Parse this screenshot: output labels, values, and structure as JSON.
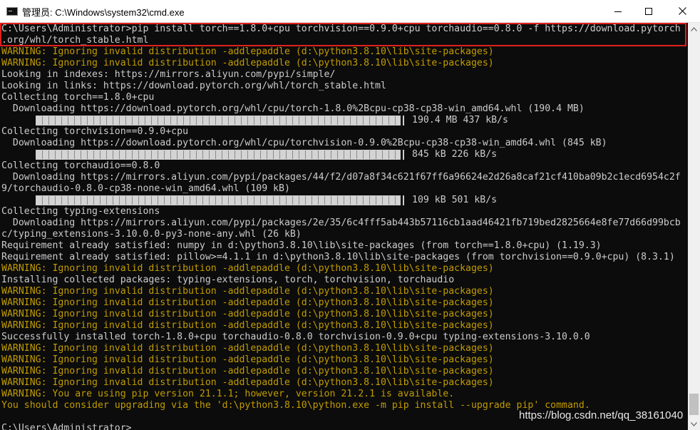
{
  "window": {
    "title": "管理员: C:\\Windows\\system32\\cmd.exe",
    "icon": "cmd-icon",
    "controls": [
      "minimize-icon",
      "maximize-icon",
      "close-icon"
    ]
  },
  "console": {
    "colors": {
      "background": "#0c0c0c",
      "text": "#cccccc",
      "warning": "#c19c00",
      "highlight": "#e0201b"
    },
    "lines": [
      {
        "text": "C:\\Users\\Administrator>pip install torch==1.8.0+cpu torchvision==0.9.0+cpu torchaudio==0.8.0 -f https://download.pytorch",
        "kind": "normal"
      },
      {
        "text": ".org/whl/torch_stable.html",
        "kind": "normal"
      },
      {
        "text": "WARNING: Ignoring invalid distribution -addlepaddle (d:\\python3.8.10\\lib\\site-packages)",
        "kind": "warning"
      },
      {
        "text": "WARNING: Ignoring invalid distribution -addlepaddle (d:\\python3.8.10\\lib\\site-packages)",
        "kind": "warning"
      },
      {
        "text": "Looking in indexes: https://mirrors.aliyun.com/pypi/simple/",
        "kind": "normal"
      },
      {
        "text": "Looking in links: https://download.pytorch.org/whl/torch_stable.html",
        "kind": "normal"
      },
      {
        "text": "Collecting torch==1.8.0+cpu",
        "kind": "normal"
      },
      {
        "text": "  Downloading https://download.pytorch.org/whl/cpu/torch-1.8.0%2Bcpu-cp38-cp38-win_amd64.whl (190.4 MB)",
        "kind": "normal"
      },
      {
        "text": "190.4 MB 437 kB/s",
        "kind": "progress",
        "progress": 1.0
      },
      {
        "text": "Collecting torchvision==0.9.0+cpu",
        "kind": "normal"
      },
      {
        "text": "  Downloading https://download.pytorch.org/whl/cpu/torchvision-0.9.0%2Bcpu-cp38-cp38-win_amd64.whl (845 kB)",
        "kind": "normal"
      },
      {
        "text": "845 kB 226 kB/s",
        "kind": "progress",
        "progress": 1.0
      },
      {
        "text": "Collecting torchaudio==0.8.0",
        "kind": "normal"
      },
      {
        "text": "  Downloading https://mirrors.aliyun.com/pypi/packages/44/f2/d07a8f34c621f67ff6a96624e2d26a8caf21cf410ba09b2c1ecd6954c2f",
        "kind": "normal"
      },
      {
        "text": "9/torchaudio-0.8.0-cp38-none-win_amd64.whl (109 kB)",
        "kind": "normal"
      },
      {
        "text": "109 kB 501 kB/s",
        "kind": "progress",
        "progress": 1.0
      },
      {
        "text": "Collecting typing-extensions",
        "kind": "normal"
      },
      {
        "text": "  Downloading https://mirrors.aliyun.com/pypi/packages/2e/35/6c4fff5ab443b57116cb1aad46421fb719bed2825664e8fe77d66d99bcb",
        "kind": "normal"
      },
      {
        "text": "c/typing_extensions-3.10.0.0-py3-none-any.whl (26 kB)",
        "kind": "normal"
      },
      {
        "text": "Requirement already satisfied: numpy in d:\\python3.8.10\\lib\\site-packages (from torch==1.8.0+cpu) (1.19.3)",
        "kind": "normal"
      },
      {
        "text": "Requirement already satisfied: pillow>=4.1.1 in d:\\python3.8.10\\lib\\site-packages (from torchvision==0.9.0+cpu) (8.3.1)",
        "kind": "normal"
      },
      {
        "text": "WARNING: Ignoring invalid distribution -addlepaddle (d:\\python3.8.10\\lib\\site-packages)",
        "kind": "warning"
      },
      {
        "text": "Installing collected packages: typing-extensions, torch, torchvision, torchaudio",
        "kind": "normal"
      },
      {
        "text": "WARNING: Ignoring invalid distribution -addlepaddle (d:\\python3.8.10\\lib\\site-packages)",
        "kind": "warning"
      },
      {
        "text": "WARNING: Ignoring invalid distribution -addlepaddle (d:\\python3.8.10\\lib\\site-packages)",
        "kind": "warning"
      },
      {
        "text": "WARNING: Ignoring invalid distribution -addlepaddle (d:\\python3.8.10\\lib\\site-packages)",
        "kind": "warning"
      },
      {
        "text": "WARNING: Ignoring invalid distribution -addlepaddle (d:\\python3.8.10\\lib\\site-packages)",
        "kind": "warning"
      },
      {
        "text": "Successfully installed torch-1.8.0+cpu torchaudio-0.8.0 torchvision-0.9.0+cpu typing-extensions-3.10.0.0",
        "kind": "normal"
      },
      {
        "text": "WARNING: Ignoring invalid distribution -addlepaddle (d:\\python3.8.10\\lib\\site-packages)",
        "kind": "warning"
      },
      {
        "text": "WARNING: Ignoring invalid distribution -addlepaddle (d:\\python3.8.10\\lib\\site-packages)",
        "kind": "warning"
      },
      {
        "text": "WARNING: Ignoring invalid distribution -addlepaddle (d:\\python3.8.10\\lib\\site-packages)",
        "kind": "warning"
      },
      {
        "text": "WARNING: Ignoring invalid distribution -addlepaddle (d:\\python3.8.10\\lib\\site-packages)",
        "kind": "warning"
      },
      {
        "text": "WARNING: You are using pip version 21.1.1; however, version 21.2.1 is available.",
        "kind": "warning"
      },
      {
        "text": "You should consider upgrading via the 'd:\\python3.8.10\\python.exe -m pip install --upgrade pip' command.",
        "kind": "warning"
      },
      {
        "text": "",
        "kind": "normal"
      },
      {
        "text": "C:\\Users\\Administrator>",
        "kind": "normal"
      }
    ]
  },
  "watermark": "https://blog.csdn.net/qq_38161040"
}
